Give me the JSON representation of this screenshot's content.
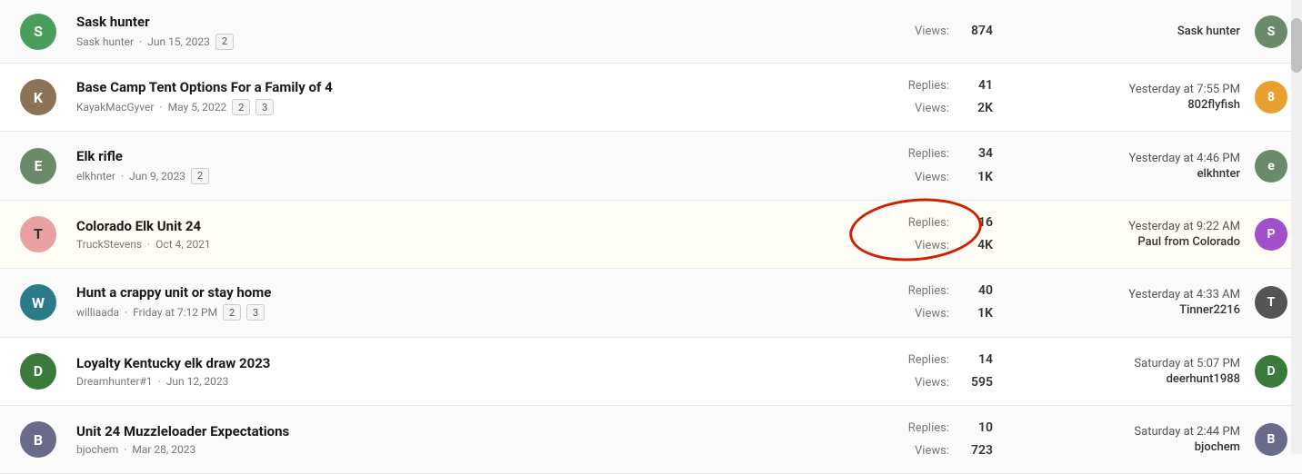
{
  "threads": [
    {
      "id": 0,
      "avatar_letter": "S",
      "avatar_class": "avatar-G",
      "title": "Sask hunter",
      "meta_user": "Sask hunter",
      "meta_date": "Jun 15, 2023",
      "pages": [
        "2"
      ],
      "replies_label": "Views:",
      "replies_value": "",
      "views_label": "",
      "views_value": "874",
      "last_time": "",
      "last_user": "Sask hunter",
      "last_avatar_letter": "S",
      "last_avatar_class": "last-avatar-elk",
      "show_replies": false
    },
    {
      "id": 1,
      "avatar_letter": "K",
      "avatar_class": "avatar-K",
      "title": "Base Camp Tent Options For a Family of 4",
      "meta_user": "KayakMacGyver",
      "meta_date": "May 5, 2022",
      "pages": [
        "2",
        "3"
      ],
      "replies_label": "Replies:",
      "replies_value": "41",
      "views_label": "Views:",
      "views_value": "2K",
      "last_time": "Yesterday at 7:55 PM",
      "last_user": "802flyfish",
      "last_avatar_letter": "8",
      "last_avatar_class": "last-avatar-8",
      "show_replies": true,
      "highlighted": false
    },
    {
      "id": 2,
      "avatar_letter": "E",
      "avatar_class": "avatar-E",
      "title": "Elk rifle",
      "meta_user": "elkhnter",
      "meta_date": "Jun 9, 2023",
      "pages": [
        "2"
      ],
      "replies_label": "Replies:",
      "replies_value": "34",
      "views_label": "Views:",
      "views_value": "1K",
      "last_time": "Yesterday at 4:46 PM",
      "last_user": "elkhnter",
      "last_avatar_letter": "e",
      "last_avatar_class": "last-avatar-elk",
      "show_replies": true
    },
    {
      "id": 3,
      "avatar_letter": "T",
      "avatar_class": "avatar-T",
      "title": "Colorado Elk Unit 24",
      "meta_user": "TruckStevens",
      "meta_date": "Oct 4, 2021",
      "pages": [],
      "replies_label": "Replies:",
      "replies_value": "16",
      "views_label": "Views:",
      "views_value": "4K",
      "last_time": "Yesterday at 9:22 AM",
      "last_user": "Paul from Colorado",
      "last_avatar_letter": "P",
      "last_avatar_class": "last-avatar-P",
      "show_replies": true,
      "circled": true
    },
    {
      "id": 4,
      "avatar_letter": "W",
      "avatar_class": "avatar-W",
      "title": "Hunt a crappy unit or stay home",
      "meta_user": "williaada",
      "meta_date": "Friday at 7:12 PM",
      "pages": [
        "2",
        "3"
      ],
      "replies_label": "Replies:",
      "replies_value": "40",
      "views_label": "Views:",
      "views_value": "1K",
      "last_time": "Yesterday at 4:33 AM",
      "last_user": "Tinner2216",
      "last_avatar_letter": "T",
      "last_avatar_class": "last-avatar-T2",
      "show_replies": true
    },
    {
      "id": 5,
      "avatar_letter": "D",
      "avatar_class": "avatar-D",
      "title": "Loyalty Kentucky elk draw 2023",
      "meta_user": "Dreamhunter#1",
      "meta_date": "Jun 12, 2023",
      "pages": [],
      "replies_label": "Replies:",
      "replies_value": "14",
      "views_label": "Views:",
      "views_value": "595",
      "last_time": "Saturday at 5:07 PM",
      "last_user": "deerhunt1988",
      "last_avatar_letter": "D",
      "last_avatar_class": "last-avatar-D",
      "show_replies": true
    },
    {
      "id": 6,
      "avatar_letter": "B",
      "avatar_class": "avatar-B",
      "title": "Unit 24 Muzzleloader Expectations",
      "meta_user": "bjochem",
      "meta_date": "Mar 28, 2023",
      "pages": [],
      "replies_label": "Replies:",
      "replies_value": "10",
      "views_label": "Views:",
      "views_value": "723",
      "last_time": "Saturday at 2:44 PM",
      "last_user": "bjochem",
      "last_avatar_letter": "B",
      "last_avatar_class": "last-avatar-B",
      "show_replies": true
    }
  ]
}
